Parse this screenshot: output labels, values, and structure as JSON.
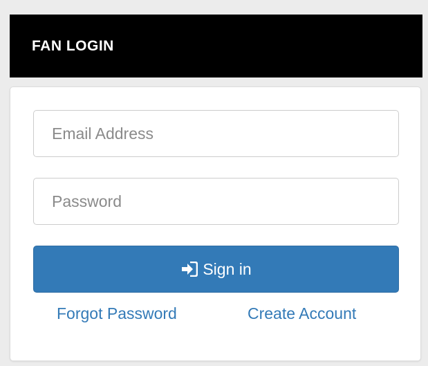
{
  "header": {
    "title": "FAN LOGIN"
  },
  "form": {
    "email_placeholder": "Email Address",
    "password_placeholder": "Password",
    "signin_label": "Sign in",
    "signin_icon": "sign-in-icon"
  },
  "links": {
    "forgot_password": "Forgot Password",
    "create_account": "Create Account"
  },
  "colors": {
    "header_bg": "#000000",
    "primary": "#337ab7",
    "page_bg": "#ececec"
  }
}
